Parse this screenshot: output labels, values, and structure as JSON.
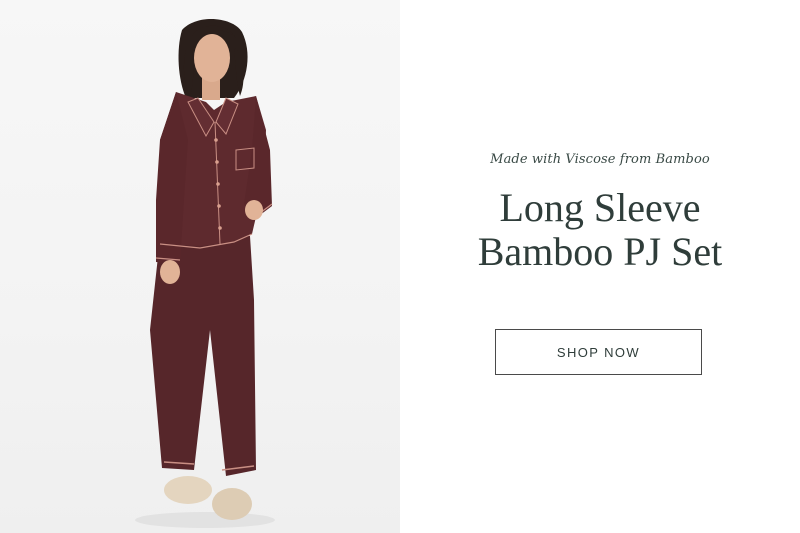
{
  "promo": {
    "eyebrow": "Made with Viscose from Bamboo",
    "headline_line1": "Long Sleeve",
    "headline_line2": "Bamboo PJ Set",
    "cta_label": "SHOP NOW"
  },
  "colors": {
    "headline": "#2f3d3a",
    "pajama": "#5e2a2e",
    "slippers": "#e4d5bf"
  },
  "image": {
    "alt": "Woman wearing a burgundy long sleeve button-up pajama set with piped trim and fuzzy slippers"
  }
}
